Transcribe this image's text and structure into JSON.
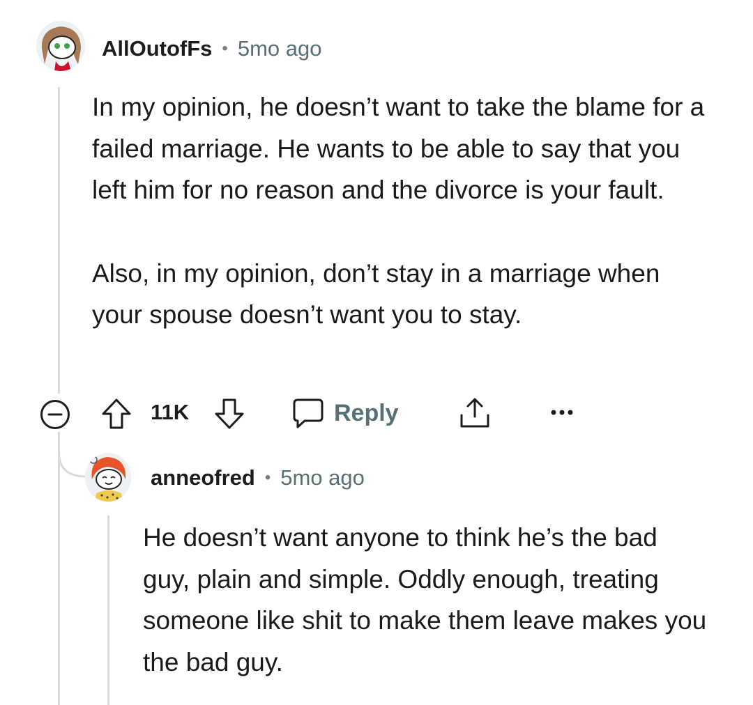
{
  "parent_comment": {
    "author": "AllOutofFs",
    "timestamp": "5mo ago",
    "avatar_icon": "snoo-avatar-brown-hair-icon",
    "paragraphs": [
      "In my opinion, he doesn’t want to take the blame for a failed marriage. He wants to be able to say that you left him for no reason and the divorce is your fault.",
      "Also, in my opinion, don’t stay in a marriage when your spouse doesn’t want you to stay."
    ],
    "actions": {
      "collapse_icon": "collapse-minus-icon",
      "upvote_icon": "upvote-arrow-icon",
      "vote_count": "11K",
      "downvote_icon": "downvote-arrow-icon",
      "reply_icon": "speech-bubble-icon",
      "reply_label": "Reply",
      "share_icon": "share-upload-icon",
      "more_icon": "more-dots-icon"
    }
  },
  "reply_comment": {
    "author": "anneofred",
    "timestamp": "5mo ago",
    "avatar_icon": "snoo-avatar-red-hair-icon",
    "paragraphs": [
      "He doesn’t want anyone to think he’s the bad guy, plain and simple. Oddly enough, treating someone like shit to make them leave makes you the bad guy."
    ]
  },
  "colors": {
    "text": "#1a1a1b",
    "meta": "#576f76",
    "thread_line": "#dadada",
    "icon_stroke": "#1c1c1c"
  }
}
